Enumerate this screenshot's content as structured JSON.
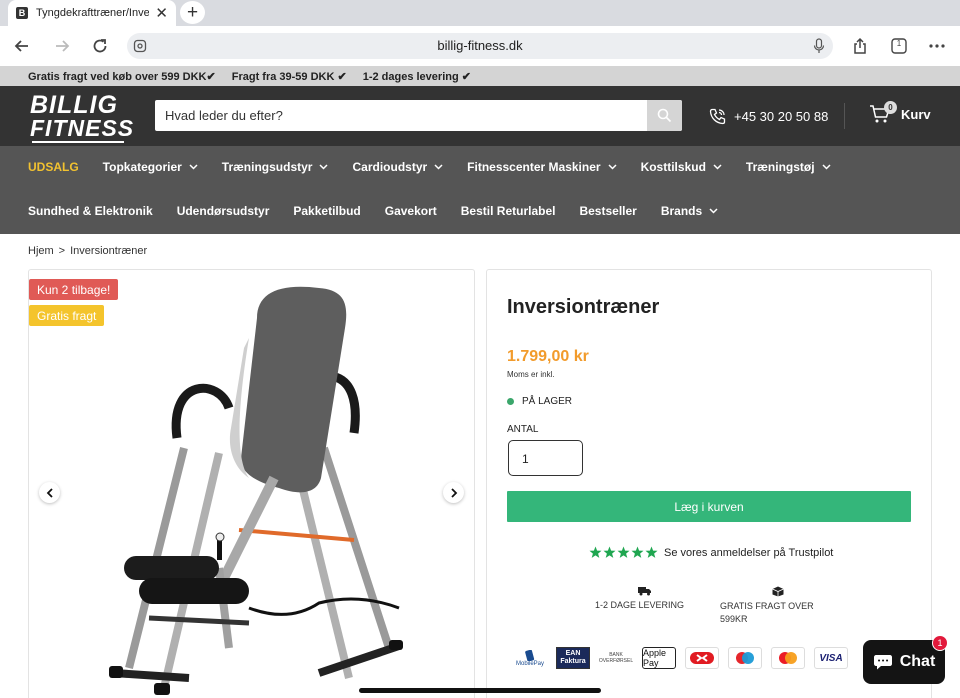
{
  "browser": {
    "tab_title": "Tyngdekrafttræner/Inversionstræner",
    "favicon_letter": "B",
    "url": "billig-fitness.dk",
    "tabs_count": "1"
  },
  "promo": {
    "items": [
      "Gratis fragt ved køb over 599 DKK✔",
      "Fragt fra 39-59 DKK ✔",
      "1-2 dages levering ✔"
    ]
  },
  "header": {
    "logo_line1": "BILLIG",
    "logo_line2": "FITNESS",
    "search_placeholder": "Hvad leder du efter?",
    "phone": "+45 30 20 50 88",
    "cart_label": "Kurv",
    "cart_count": "0"
  },
  "menu": {
    "row1": [
      {
        "label": "UDSALG",
        "dropdown": false
      },
      {
        "label": "Topkategorier",
        "dropdown": true
      },
      {
        "label": "Træningsudstyr",
        "dropdown": true
      },
      {
        "label": "Cardioudstyr",
        "dropdown": true
      },
      {
        "label": "Fitnesscenter Maskiner",
        "dropdown": true
      },
      {
        "label": "Kosttilskud",
        "dropdown": true
      },
      {
        "label": "Træningstøj",
        "dropdown": true
      }
    ],
    "row2": [
      {
        "label": "Sundhed & Elektronik",
        "dropdown": false
      },
      {
        "label": "Udendørsudstyr",
        "dropdown": false
      },
      {
        "label": "Pakketilbud",
        "dropdown": false
      },
      {
        "label": "Gavekort",
        "dropdown": false
      },
      {
        "label": "Bestil Returlabel",
        "dropdown": false
      },
      {
        "label": "Bestseller",
        "dropdown": false
      },
      {
        "label": "Brands",
        "dropdown": true
      }
    ]
  },
  "breadcrumb": {
    "home": "Hjem",
    "separator": ">",
    "current": "Inversiontræner"
  },
  "gallery": {
    "badge_stock": "Kun 2 tilbage!",
    "badge_shipping": "Gratis fragt"
  },
  "product": {
    "title": "Inversiontræner",
    "price": "1.799,00 kr",
    "vat_note": "Moms er inkl.",
    "stock_status": "PÅ LAGER",
    "quantity_label": "ANTAL",
    "quantity_value": "1",
    "add_to_cart": "Læg i kurven",
    "trustpilot_text": "Se vores anmeldelser på Trustpilot",
    "rating_stars": 5,
    "feature1": "1-2 DAGE LEVERING",
    "feature2_line1": "GRATIS FRAGT OVER",
    "feature2_line2": "599KR",
    "payments": [
      "MobilePay",
      "EAN Faktura",
      "BANK OVERFØRSEL",
      "Apple Pay",
      "Dankort",
      "Maestro",
      "Mastercard",
      "VISA"
    ]
  },
  "chat": {
    "label": "Chat",
    "unread": "1"
  },
  "colors": {
    "accent_green": "#34b67a",
    "price_orange": "#f29b2b",
    "sale_yellow": "#f2c230",
    "badge_red": "#e05a56",
    "badge_yellow": "#f4c42c"
  }
}
